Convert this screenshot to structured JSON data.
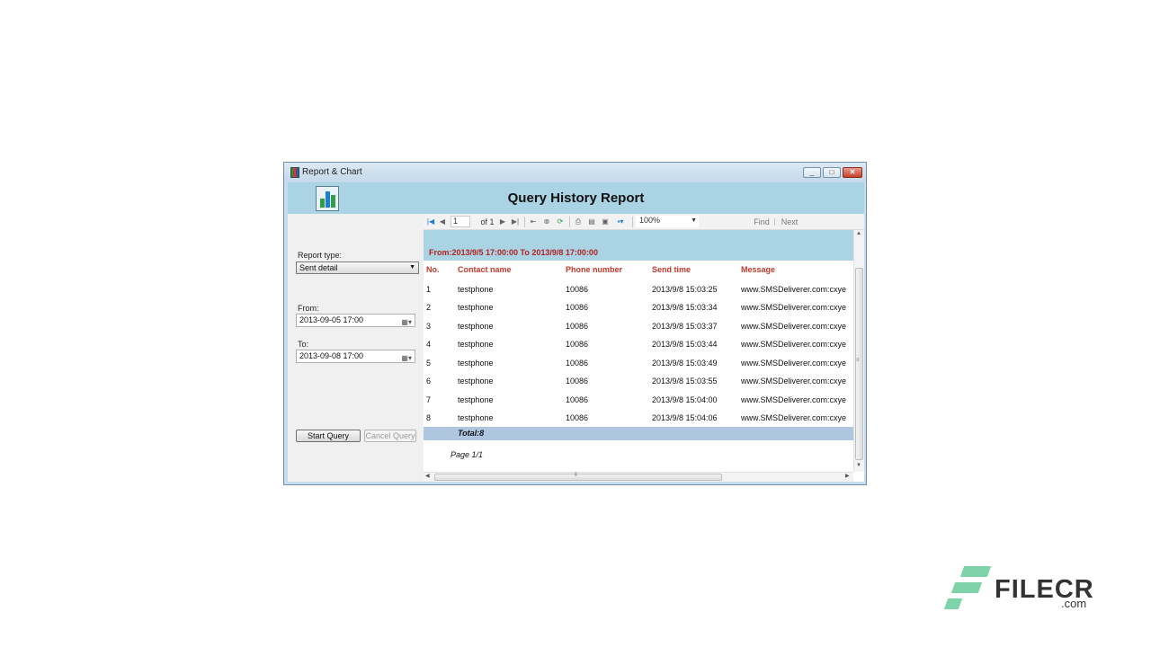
{
  "window": {
    "title": "Report & Chart",
    "controls": [
      "_",
      "□",
      "✕"
    ]
  },
  "header": {
    "title": "Query History Report"
  },
  "left": {
    "report_type_label": "Report type:",
    "report_type_value": "Sent detail",
    "from_label": "From:",
    "from_value": "2013-09-05 17:00",
    "to_label": "To:",
    "to_value": "2013-09-08 17:00",
    "start_query": "Start Query",
    "cancel_query": "Cancel Query"
  },
  "toolbar": {
    "page_value": "1",
    "of_label": "of 1",
    "zoom": "100%",
    "find": "Find",
    "next": "Next"
  },
  "report": {
    "range": "From:2013/9/5 17:00:00 To 2013/9/8 17:00:00",
    "columns": [
      "No.",
      "Contact name",
      "Phone number",
      "Send time",
      "Message"
    ],
    "rows": [
      [
        "1",
        "testphone",
        "10086",
        "2013/9/8 15:03:25",
        "www.SMSDeliverer.com:cxye"
      ],
      [
        "2",
        "testphone",
        "10086",
        "2013/9/8 15:03:34",
        "www.SMSDeliverer.com:cxye"
      ],
      [
        "3",
        "testphone",
        "10086",
        "2013/9/8 15:03:37",
        "www.SMSDeliverer.com:cxye"
      ],
      [
        "4",
        "testphone",
        "10086",
        "2013/9/8 15:03:44",
        "www.SMSDeliverer.com:cxye"
      ],
      [
        "5",
        "testphone",
        "10086",
        "2013/9/8 15:03:49",
        "www.SMSDeliverer.com:cxye"
      ],
      [
        "6",
        "testphone",
        "10086",
        "2013/9/8 15:03:55",
        "www.SMSDeliverer.com:cxye"
      ],
      [
        "7",
        "testphone",
        "10086",
        "2013/9/8 15:04:00",
        "www.SMSDeliverer.com:cxye"
      ],
      [
        "8",
        "testphone",
        "10086",
        "2013/9/8 15:04:06",
        "www.SMSDeliverer.com:cxye"
      ]
    ],
    "total": "Total:8",
    "page": "Page 1/1"
  },
  "watermark": {
    "brand": "FILECR",
    "suffix": ".com"
  },
  "colors": {
    "header_band": "#aad3e3",
    "accent_red": "#c0392b",
    "total_band": "#aec6e0",
    "watermark_green": "#7ed3a8"
  }
}
